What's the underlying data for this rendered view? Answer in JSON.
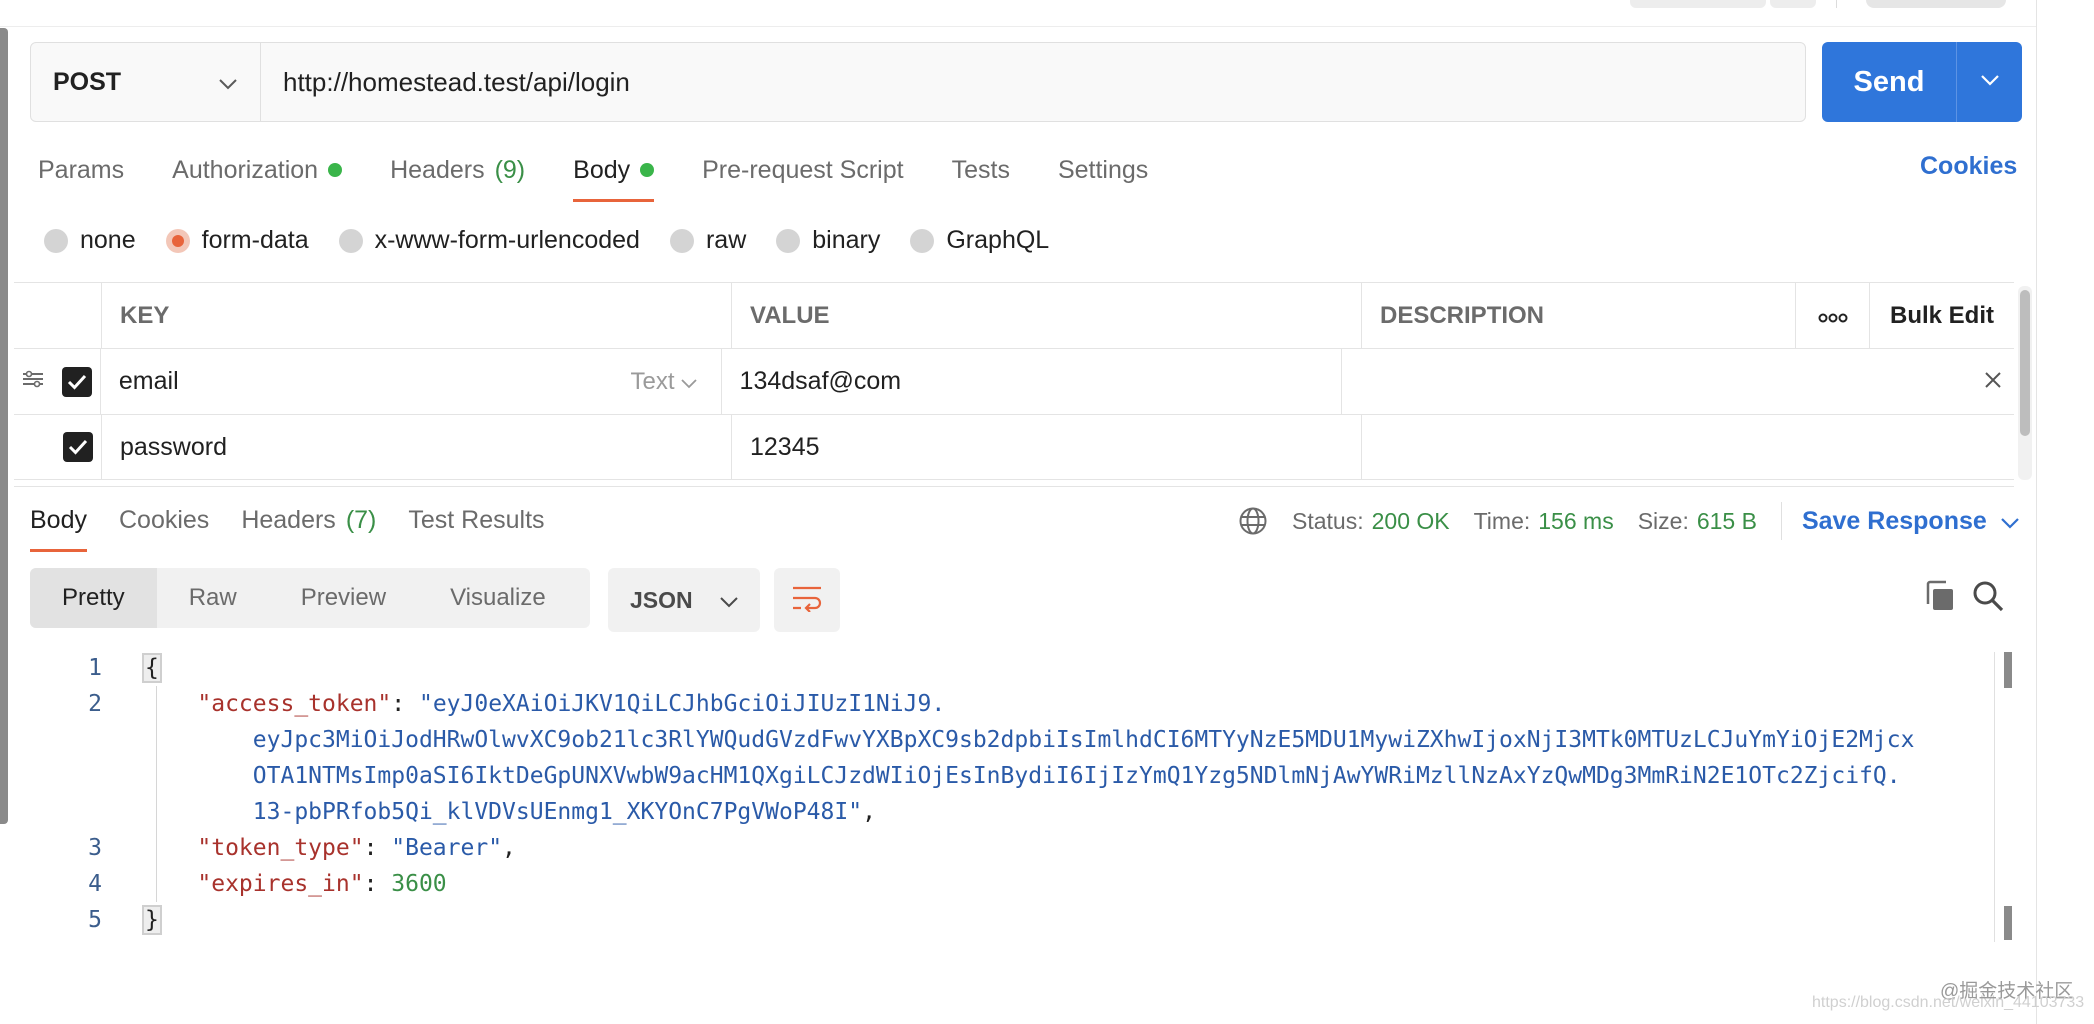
{
  "request": {
    "method": "POST",
    "url": "http://homestead.test/api/login",
    "send_label": "Send"
  },
  "request_tabs": [
    {
      "label": "Params"
    },
    {
      "label": "Authorization"
    },
    {
      "label": "Headers",
      "count": "(9)"
    },
    {
      "label": "Body"
    },
    {
      "label": "Pre-request Script"
    },
    {
      "label": "Tests"
    },
    {
      "label": "Settings"
    }
  ],
  "cookies_link": "Cookies",
  "body_types": [
    "none",
    "form-data",
    "x-www-form-urlencoded",
    "raw",
    "binary",
    "GraphQL"
  ],
  "body_type_selected": "form-data",
  "params_table": {
    "headers": {
      "key": "KEY",
      "value": "VALUE",
      "description": "DESCRIPTION",
      "bulk_edit": "Bulk Edit"
    },
    "rows": [
      {
        "key": "email",
        "type": "Text",
        "value": "134dsaf@com",
        "description": "",
        "checked": true
      },
      {
        "key": "password",
        "type": "",
        "value": "12345",
        "description": "",
        "checked": true
      }
    ]
  },
  "response_tabs": [
    {
      "label": "Body"
    },
    {
      "label": "Cookies"
    },
    {
      "label": "Headers",
      "count": "(7)"
    },
    {
      "label": "Test Results"
    }
  ],
  "response_status": {
    "status_label": "Status:",
    "status_value": "200 OK",
    "time_label": "Time:",
    "time_value": "156 ms",
    "size_label": "Size:",
    "size_value": "615 B",
    "save_label": "Save Response"
  },
  "view_modes": [
    "Pretty",
    "Raw",
    "Preview",
    "Visualize"
  ],
  "format": "JSON",
  "code": {
    "line_numbers": [
      "1",
      "2",
      "",
      "",
      "",
      "3",
      "4",
      "5"
    ],
    "open_brace": "{",
    "close_brace": "}",
    "access_token_key": "\"access_token\"",
    "access_token_lines": [
      "\"eyJ0eXAiOiJKV1QiLCJhbGciOiJIUzI1NiJ9.",
      "eyJpc3MiOiJodHRwOlwvXC9ob21lc3RlYWQudGVzdFwvYXBpXC9sb2dpbiIsImlhdCI6MTYyNzE5MDU1MywiZXhwIjoxNjI3MTk0MTUzLCJuYmYiOjE2Mjcx",
      "OTA1NTMsImp0aSI6IktDeGpUNXVwbW9acHM1QXgiLCJzdWIiOjEsInBydiI6IjIzYmQ1Yzg5NDlmNjAwYWRiMzllNzAxYzQwMDg3MmRiN2E1OTc2ZjcifQ.",
      "13-pbPRfob5Qi_klVDVsUEnmg1_XKYOnC7PgVWoP48I\""
    ],
    "token_type_key": "\"token_type\"",
    "token_type_value": "\"Bearer\"",
    "expires_in_key": "\"expires_in\"",
    "expires_in_value": "3600"
  },
  "watermark": "@掘金技术社区",
  "watermark_url": "https://blog.csdn.net/weixin_44103733"
}
